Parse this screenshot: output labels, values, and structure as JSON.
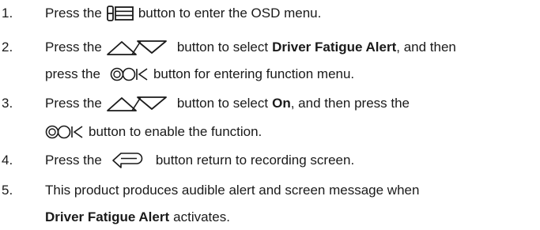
{
  "steps": [
    {
      "number": "1.",
      "lines": [
        {
          "before": "Press the",
          "icon": "menu-icon",
          "after": "button to enter the OSD menu."
        }
      ]
    },
    {
      "number": "2.",
      "lines": [
        {
          "before": "Press the",
          "icon": "up-down-icon",
          "after_a": "button to select",
          "bold": "Driver Fatigue Alert",
          "after_b": ", and then"
        },
        {
          "before": "press the",
          "icon": "ok-icon",
          "after": "button for entering function menu."
        }
      ]
    },
    {
      "number": "3.",
      "lines": [
        {
          "before": "Press the",
          "icon": "up-down-icon",
          "after_a": "button to select",
          "bold": "On",
          "after_b": ", and then press the"
        },
        {
          "icon": "ok-icon",
          "after": "button to enable the function."
        }
      ]
    },
    {
      "number": "4.",
      "lines": [
        {
          "before": "Press the",
          "icon": "return-icon",
          "after": "button return to recording screen."
        }
      ]
    },
    {
      "number": "5.",
      "lines": [
        {
          "before": "This product produces audible alert and screen message when"
        },
        {
          "bold": "Driver Fatigue Alert",
          "after": "activates."
        }
      ]
    }
  ],
  "icons": {
    "menu": "menu-icon",
    "up_down": "up-down-icon",
    "ok": "ok-icon",
    "return": "return-icon"
  }
}
